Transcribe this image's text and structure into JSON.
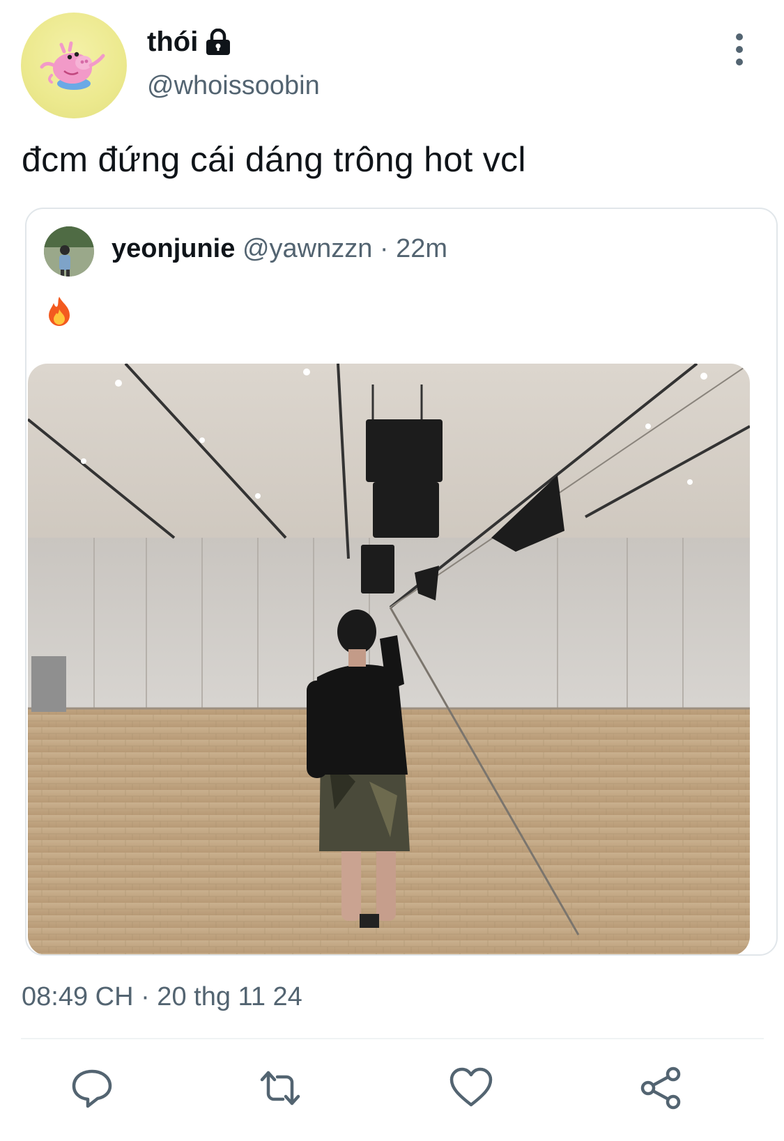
{
  "tweet": {
    "display_name": "thói",
    "handle": "@whoissoobin",
    "text": "đcm đứng cái dáng trông hot vcl",
    "timestamp": "08:49 CH · 20 thg 11 24"
  },
  "quoted_tweet": {
    "display_name": "yeonjunie",
    "handle": "@yawnzzn",
    "separator": "·",
    "time": "22m",
    "text": "🔥"
  },
  "icons": {
    "lock": "lock-icon",
    "more": "more-options-icon",
    "reply": "reply-icon",
    "retweet": "retweet-icon",
    "like": "heart-icon",
    "share": "share-icon"
  },
  "colors": {
    "text_primary": "#0f1419",
    "text_secondary": "#536471",
    "border": "#e1e6ea",
    "action_icon": "#536471"
  }
}
